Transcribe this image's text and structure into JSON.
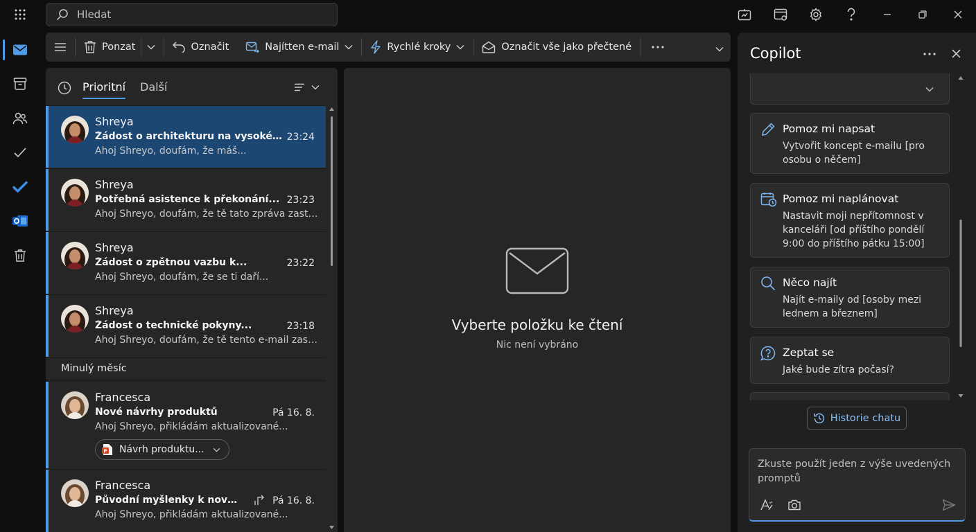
{
  "search": {
    "placeholder": "Hledat"
  },
  "ribbon": {
    "ignore_label": "Ponzat",
    "mark_label": "Označit",
    "find_email_label": "Najítten e-mail",
    "quick_steps_label": "Rychlé kroky",
    "mark_all_read_label": "Označit vše jako přečtené"
  },
  "list": {
    "tabs": [
      "Prioritní",
      "Další"
    ],
    "group_last_month": "Minulý měsíc",
    "messages": [
      {
        "sender": "Shreya",
        "subject": "Žádost o architekturu na vysoké úrovni...",
        "time": "23:24",
        "preview": "Ahoj Shreyo, doufám, že máš..."
      },
      {
        "sender": "Shreya",
        "subject": "Potřebná asistence k překonání...",
        "time": "23:23",
        "preview": "Ahoj Shreyo, doufám, že tě tato zpráva zastihne..."
      },
      {
        "sender": "Shreya",
        "subject": "Žádost o zpětnou vazbu k...",
        "time": "23:22",
        "preview": "Ahoj Shreyo, doufám, že se ti daří..."
      },
      {
        "sender": "Shreya",
        "subject": "Žádost o technické pokyny...",
        "time": "23:18",
        "preview": "Ahoj Shreyo, doufám, že tě tento e-mail zastihne..."
      },
      {
        "sender": "Francesca",
        "subject": "Nové návrhy produktů",
        "time": "Pá 16. 8.",
        "preview": "Ahoj Shreyo, přikládám aktualizované...",
        "attachment": "Návrh produktu..."
      },
      {
        "sender": "Francesca",
        "subject": "Původní myšlenky k novému...",
        "time": "Pá 16. 8.",
        "preview": "Ahoj Shreyo, přikládám aktualizované..."
      }
    ]
  },
  "reading": {
    "empty_title": "Vyberte položku ke čtení",
    "empty_sub": "Nic není vybráno"
  },
  "copilot": {
    "title": "Copilot",
    "cards": [
      {
        "title": "Pomoz mi napsat",
        "desc": "Vytvořit koncept e-mailu [pro osobu o něčem]"
      },
      {
        "title": "Pomoz mi naplánovat",
        "desc": "Nastavit moji nepřítomnost v kanceláři [od příštího pondělí 9:00 do příštího pátku 15:00]"
      },
      {
        "title": "Něco najít",
        "desc": "Najít e-maily od [osoby mezi lednem a březnem]"
      },
      {
        "title": "Zeptat se",
        "desc": "Jaké bude zítra počasí?"
      }
    ],
    "history_label": "Historie chatu",
    "prompt_placeholder": "Zkuste použít jeden z výše uvedených promptů"
  }
}
